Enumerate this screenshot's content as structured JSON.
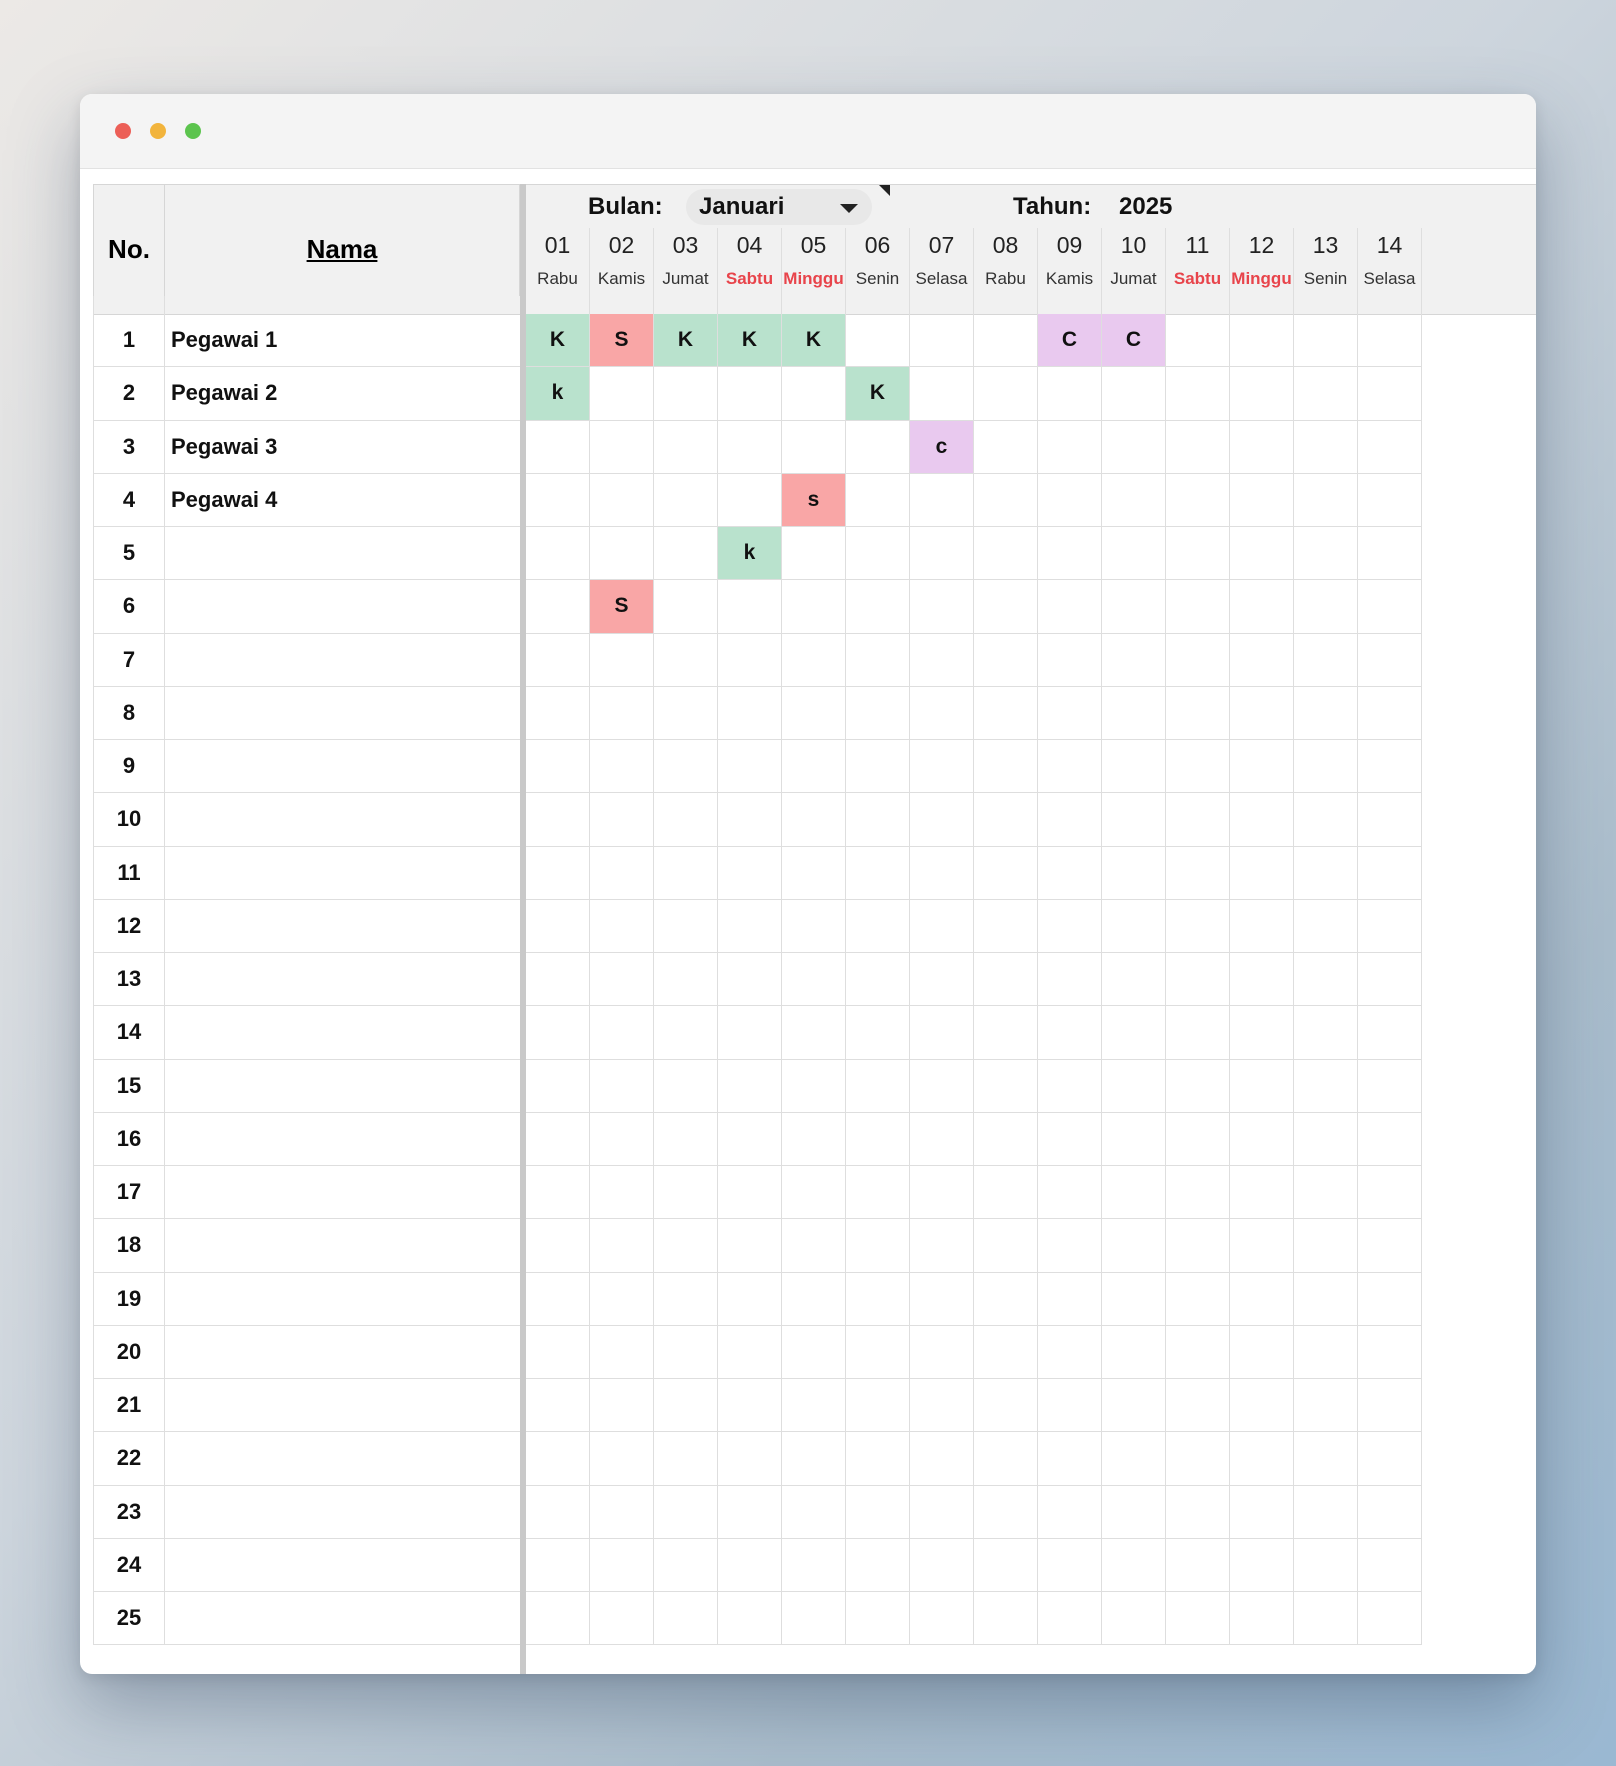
{
  "window": {
    "controls": [
      "close",
      "minimize",
      "zoom"
    ]
  },
  "header": {
    "no_label": "No.",
    "name_label": "Nama",
    "bulan_label": "Bulan:",
    "month_value": "Januari",
    "tahun_label": "Tahun:",
    "year_value": "2025"
  },
  "days": [
    {
      "num": "01",
      "name": "Rabu",
      "weekend": false
    },
    {
      "num": "02",
      "name": "Kamis",
      "weekend": false
    },
    {
      "num": "03",
      "name": "Jumat",
      "weekend": false
    },
    {
      "num": "04",
      "name": "Sabtu",
      "weekend": true
    },
    {
      "num": "05",
      "name": "Minggu",
      "weekend": true
    },
    {
      "num": "06",
      "name": "Senin",
      "weekend": false
    },
    {
      "num": "07",
      "name": "Selasa",
      "weekend": false
    },
    {
      "num": "08",
      "name": "Rabu",
      "weekend": false
    },
    {
      "num": "09",
      "name": "Kamis",
      "weekend": false
    },
    {
      "num": "10",
      "name": "Jumat",
      "weekend": false
    },
    {
      "num": "11",
      "name": "Sabtu",
      "weekend": true
    },
    {
      "num": "12",
      "name": "Minggu",
      "weekend": true
    },
    {
      "num": "13",
      "name": "Senin",
      "weekend": false
    },
    {
      "num": "14",
      "name": "Selasa",
      "weekend": false
    }
  ],
  "code_colors": {
    "K": "#b9e2cd",
    "S": "#f9a6a6",
    "C": "#e9c9ef"
  },
  "rows": [
    {
      "no": "1",
      "name": "Pegawai 1",
      "cells": [
        "K",
        "S",
        "K",
        "K",
        "K",
        "",
        "",
        "",
        "C",
        "C",
        "",
        "",
        "",
        ""
      ]
    },
    {
      "no": "2",
      "name": "Pegawai 2",
      "cells": [
        "k",
        "",
        "",
        "",
        "",
        "K",
        "",
        "",
        "",
        "",
        "",
        "",
        "",
        ""
      ]
    },
    {
      "no": "3",
      "name": "Pegawai 3",
      "cells": [
        "",
        "",
        "",
        "",
        "",
        "",
        "c",
        "",
        "",
        "",
        "",
        "",
        "",
        ""
      ]
    },
    {
      "no": "4",
      "name": "Pegawai 4",
      "cells": [
        "",
        "",
        "",
        "",
        "s",
        "",
        "",
        "",
        "",
        "",
        "",
        "",
        "",
        ""
      ]
    },
    {
      "no": "5",
      "name": "",
      "cells": [
        "",
        "",
        "",
        "k",
        "",
        "",
        "",
        "",
        "",
        "",
        "",
        "",
        "",
        ""
      ]
    },
    {
      "no": "6",
      "name": "",
      "cells": [
        "",
        "S",
        "",
        "",
        "",
        "",
        "",
        "",
        "",
        "",
        "",
        "",
        "",
        ""
      ]
    },
    {
      "no": "7",
      "name": "",
      "cells": [
        "",
        "",
        "",
        "",
        "",
        "",
        "",
        "",
        "",
        "",
        "",
        "",
        "",
        ""
      ]
    },
    {
      "no": "8",
      "name": "",
      "cells": [
        "",
        "",
        "",
        "",
        "",
        "",
        "",
        "",
        "",
        "",
        "",
        "",
        "",
        ""
      ]
    },
    {
      "no": "9",
      "name": "",
      "cells": [
        "",
        "",
        "",
        "",
        "",
        "",
        "",
        "",
        "",
        "",
        "",
        "",
        "",
        ""
      ]
    },
    {
      "no": "10",
      "name": "",
      "cells": [
        "",
        "",
        "",
        "",
        "",
        "",
        "",
        "",
        "",
        "",
        "",
        "",
        "",
        ""
      ]
    },
    {
      "no": "11",
      "name": "",
      "cells": [
        "",
        "",
        "",
        "",
        "",
        "",
        "",
        "",
        "",
        "",
        "",
        "",
        "",
        ""
      ]
    },
    {
      "no": "12",
      "name": "",
      "cells": [
        "",
        "",
        "",
        "",
        "",
        "",
        "",
        "",
        "",
        "",
        "",
        "",
        "",
        ""
      ]
    },
    {
      "no": "13",
      "name": "",
      "cells": [
        "",
        "",
        "",
        "",
        "",
        "",
        "",
        "",
        "",
        "",
        "",
        "",
        "",
        ""
      ]
    },
    {
      "no": "14",
      "name": "",
      "cells": [
        "",
        "",
        "",
        "",
        "",
        "",
        "",
        "",
        "",
        "",
        "",
        "",
        "",
        ""
      ]
    },
    {
      "no": "15",
      "name": "",
      "cells": [
        "",
        "",
        "",
        "",
        "",
        "",
        "",
        "",
        "",
        "",
        "",
        "",
        "",
        ""
      ]
    },
    {
      "no": "16",
      "name": "",
      "cells": [
        "",
        "",
        "",
        "",
        "",
        "",
        "",
        "",
        "",
        "",
        "",
        "",
        "",
        ""
      ]
    },
    {
      "no": "17",
      "name": "",
      "cells": [
        "",
        "",
        "",
        "",
        "",
        "",
        "",
        "",
        "",
        "",
        "",
        "",
        "",
        ""
      ]
    },
    {
      "no": "18",
      "name": "",
      "cells": [
        "",
        "",
        "",
        "",
        "",
        "",
        "",
        "",
        "",
        "",
        "",
        "",
        "",
        ""
      ]
    },
    {
      "no": "19",
      "name": "",
      "cells": [
        "",
        "",
        "",
        "",
        "",
        "",
        "",
        "",
        "",
        "",
        "",
        "",
        "",
        ""
      ]
    },
    {
      "no": "20",
      "name": "",
      "cells": [
        "",
        "",
        "",
        "",
        "",
        "",
        "",
        "",
        "",
        "",
        "",
        "",
        "",
        ""
      ]
    },
    {
      "no": "21",
      "name": "",
      "cells": [
        "",
        "",
        "",
        "",
        "",
        "",
        "",
        "",
        "",
        "",
        "",
        "",
        "",
        ""
      ]
    },
    {
      "no": "22",
      "name": "",
      "cells": [
        "",
        "",
        "",
        "",
        "",
        "",
        "",
        "",
        "",
        "",
        "",
        "",
        "",
        ""
      ]
    },
    {
      "no": "23",
      "name": "",
      "cells": [
        "",
        "",
        "",
        "",
        "",
        "",
        "",
        "",
        "",
        "",
        "",
        "",
        "",
        ""
      ]
    },
    {
      "no": "24",
      "name": "",
      "cells": [
        "",
        "",
        "",
        "",
        "",
        "",
        "",
        "",
        "",
        "",
        "",
        "",
        "",
        ""
      ]
    },
    {
      "no": "25",
      "name": "",
      "cells": [
        "",
        "",
        "",
        "",
        "",
        "",
        "",
        "",
        "",
        "",
        "",
        "",
        "",
        ""
      ]
    }
  ]
}
